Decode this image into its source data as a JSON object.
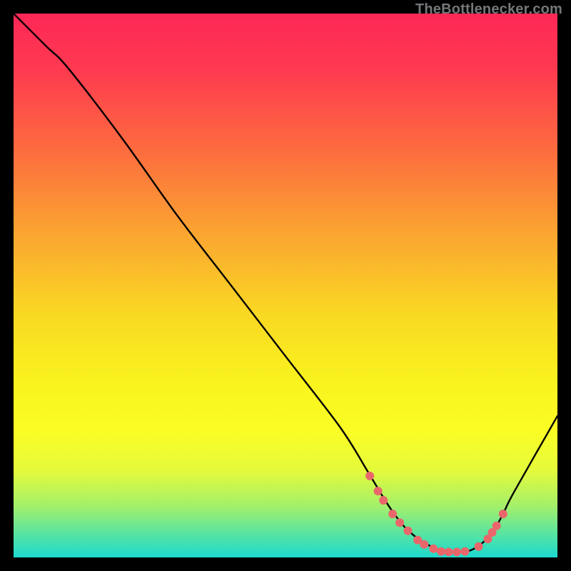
{
  "credit": "TheBottlenecker.com",
  "colors": {
    "background": "#000000",
    "credit_text": "#74777a",
    "curve": "#000000",
    "marker": "#e9676b",
    "gradient_stops": [
      {
        "offset": 0.0,
        "color": "#fe2757"
      },
      {
        "offset": 0.1,
        "color": "#fe3950"
      },
      {
        "offset": 0.25,
        "color": "#fd6b3f"
      },
      {
        "offset": 0.4,
        "color": "#fba331"
      },
      {
        "offset": 0.55,
        "color": "#f9d823"
      },
      {
        "offset": 0.68,
        "color": "#f9f31e"
      },
      {
        "offset": 0.77,
        "color": "#fafd25"
      },
      {
        "offset": 0.84,
        "color": "#e4fa3b"
      },
      {
        "offset": 0.905,
        "color": "#a4f06a"
      },
      {
        "offset": 0.955,
        "color": "#5ae49f"
      },
      {
        "offset": 1.0,
        "color": "#1cdacf"
      }
    ]
  },
  "chart_data": {
    "type": "line",
    "title": "",
    "xlabel": "",
    "ylabel": "",
    "xlim": [
      0,
      100
    ],
    "ylim": [
      0,
      100
    ],
    "series": [
      {
        "name": "bottleneck-curve",
        "x": [
          0,
          6,
          10,
          20,
          30,
          40,
          50,
          60,
          65,
          68,
          70,
          72,
          75,
          78,
          80,
          82,
          84,
          86,
          88,
          90,
          92,
          100
        ],
        "y": [
          100,
          94,
          90,
          77,
          63,
          50,
          37,
          24,
          16,
          11,
          8,
          5.5,
          3,
          1.5,
          1,
          1,
          1.3,
          2.5,
          4.5,
          8,
          12,
          26
        ]
      }
    ],
    "markers": {
      "name": "highlight-points",
      "x": [
        65.5,
        67.0,
        68.0,
        69.7,
        71.0,
        72.5,
        74.3,
        75.5,
        77.2,
        78.6,
        80.0,
        81.5,
        83.0,
        85.5,
        87.2,
        88.0,
        88.8,
        90.0
      ],
      "y": [
        15.0,
        12.2,
        10.5,
        8.0,
        6.4,
        4.9,
        3.2,
        2.4,
        1.6,
        1.1,
        1.0,
        1.0,
        1.1,
        2.0,
        3.4,
        4.6,
        5.8,
        8.0
      ]
    }
  }
}
